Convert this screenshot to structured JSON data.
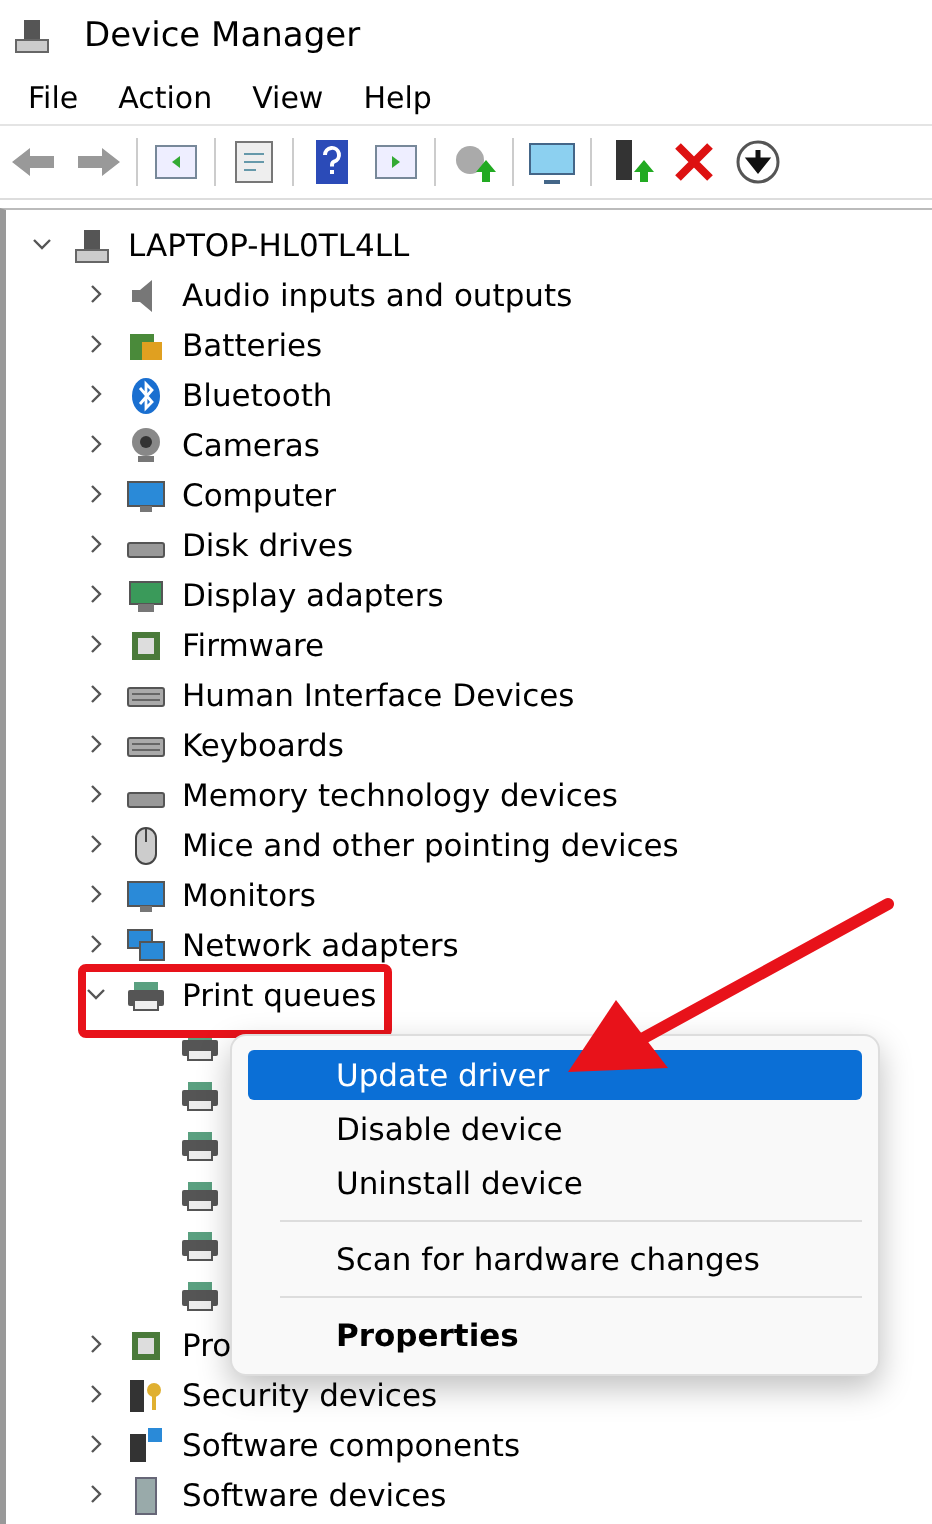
{
  "window": {
    "title": "Device Manager"
  },
  "menu_bar": [
    "File",
    "Action",
    "View",
    "Help"
  ],
  "tree": {
    "label": "LAPTOP-HL0TL4LL",
    "kind": "computer",
    "expanded": true,
    "children": [
      {
        "label": "Audio inputs and outputs",
        "kind": "speaker",
        "expanded": false
      },
      {
        "label": "Batteries",
        "kind": "battery",
        "expanded": false
      },
      {
        "label": "Bluetooth",
        "kind": "bluetooth",
        "expanded": false
      },
      {
        "label": "Cameras",
        "kind": "camera",
        "expanded": false
      },
      {
        "label": "Computer",
        "kind": "monitor",
        "expanded": false
      },
      {
        "label": "Disk drives",
        "kind": "disk",
        "expanded": false
      },
      {
        "label": "Display adapters",
        "kind": "display",
        "expanded": false
      },
      {
        "label": "Firmware",
        "kind": "chip",
        "expanded": false
      },
      {
        "label": "Human Interface Devices",
        "kind": "keyboard",
        "expanded": false
      },
      {
        "label": "Keyboards",
        "kind": "keyboard",
        "expanded": false
      },
      {
        "label": "Memory technology devices",
        "kind": "disk",
        "expanded": false
      },
      {
        "label": "Mice and other pointing devices",
        "kind": "mouse",
        "expanded": false
      },
      {
        "label": "Monitors",
        "kind": "monitor",
        "expanded": false
      },
      {
        "label": "Network adapters",
        "kind": "network",
        "expanded": false
      },
      {
        "label": "Print queues",
        "kind": "printer",
        "expanded": true,
        "children": [
          {
            "kind": "printer"
          },
          {
            "kind": "printer"
          },
          {
            "kind": "printer"
          },
          {
            "kind": "printer"
          },
          {
            "kind": "printer"
          },
          {
            "kind": "printer"
          }
        ]
      },
      {
        "label": "Pro",
        "kind": "chip",
        "expanded": false
      },
      {
        "label": "Security devices",
        "kind": "key",
        "expanded": false
      },
      {
        "label": "Software components",
        "kind": "puzzle",
        "expanded": false
      },
      {
        "label": "Software devices",
        "kind": "tower",
        "expanded": false
      }
    ]
  },
  "context_menu": [
    {
      "kind": "item",
      "label": "Update driver",
      "selected": true,
      "default": false
    },
    {
      "kind": "item",
      "label": "Disable device",
      "selected": false,
      "default": false
    },
    {
      "kind": "item",
      "label": "Uninstall device",
      "selected": false,
      "default": false
    },
    {
      "kind": "separator"
    },
    {
      "kind": "item",
      "label": "Scan for hardware changes",
      "selected": false,
      "default": false
    },
    {
      "kind": "separator"
    },
    {
      "kind": "item",
      "label": "Properties",
      "selected": false,
      "default": true
    }
  ]
}
